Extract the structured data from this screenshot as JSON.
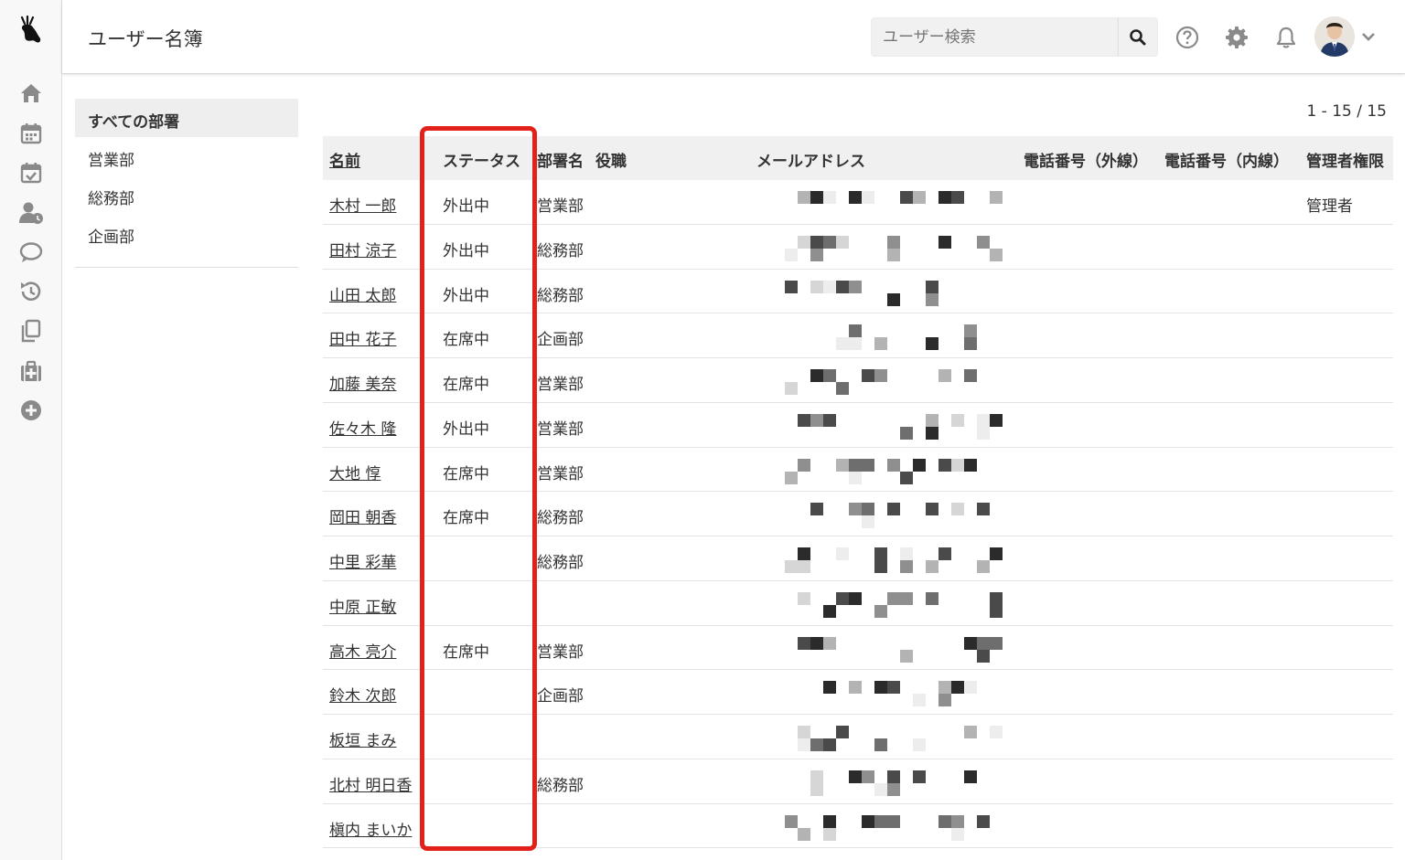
{
  "header": {
    "title": "ユーザー名簿",
    "search_placeholder": "ユーザー検索"
  },
  "icons": {
    "logo": "deer-logo-icon",
    "rail": [
      "home-icon",
      "calendar-icon",
      "calendar-check-icon",
      "user-clock-icon",
      "chat-icon",
      "history-icon",
      "copy-icon",
      "medkit-icon",
      "plus-circle-icon"
    ],
    "header": [
      "search-icon",
      "help-icon",
      "gear-icon",
      "bell-icon",
      "chevron-down-icon"
    ]
  },
  "departments": {
    "items": [
      {
        "label": "すべての部署",
        "active": true
      },
      {
        "label": "営業部",
        "active": false
      },
      {
        "label": "総務部",
        "active": false
      },
      {
        "label": "企画部",
        "active": false
      }
    ]
  },
  "pager": "1 - 15 / 15",
  "table": {
    "headers": {
      "name": "名前",
      "status": "ステータス",
      "dept": "部署名",
      "role": "役職",
      "email": "メールアドレス",
      "phone_ext": "電話番号（外線）",
      "phone_int": "電話番号（内線）",
      "admin": "管理者権限"
    },
    "rows": [
      {
        "name": "木村 一郎",
        "status": "外出中",
        "dept": "営業部",
        "admin": "管理者"
      },
      {
        "name": "田村 涼子",
        "status": "外出中",
        "dept": "総務部",
        "admin": ""
      },
      {
        "name": "山田 太郎",
        "status": "外出中",
        "dept": "総務部",
        "admin": ""
      },
      {
        "name": "田中 花子",
        "status": "在席中",
        "dept": "企画部",
        "admin": ""
      },
      {
        "name": "加藤 美奈",
        "status": "在席中",
        "dept": "営業部",
        "admin": ""
      },
      {
        "name": "佐々木 隆",
        "status": "外出中",
        "dept": "営業部",
        "admin": ""
      },
      {
        "name": "大地 惇",
        "status": "在席中",
        "dept": "営業部",
        "admin": ""
      },
      {
        "name": "岡田 朝香",
        "status": "在席中",
        "dept": "総務部",
        "admin": ""
      },
      {
        "name": "中里 彩華",
        "status": "",
        "dept": "総務部",
        "admin": ""
      },
      {
        "name": "中原 正敏",
        "status": "",
        "dept": "",
        "admin": ""
      },
      {
        "name": "高木 亮介",
        "status": "在席中",
        "dept": "営業部",
        "admin": ""
      },
      {
        "name": "鈴木 次郎",
        "status": "",
        "dept": "企画部",
        "admin": ""
      },
      {
        "name": "板垣 まみ",
        "status": "",
        "dept": "",
        "admin": ""
      },
      {
        "name": "北村 明日香",
        "status": "",
        "dept": "総務部",
        "admin": ""
      },
      {
        "name": "槇内 まいか",
        "status": "",
        "dept": "",
        "admin": ""
      }
    ]
  },
  "colors": {
    "highlight": "#e3211b",
    "icon": "#8a8a8a",
    "header_bg": "#f0f0f0"
  }
}
